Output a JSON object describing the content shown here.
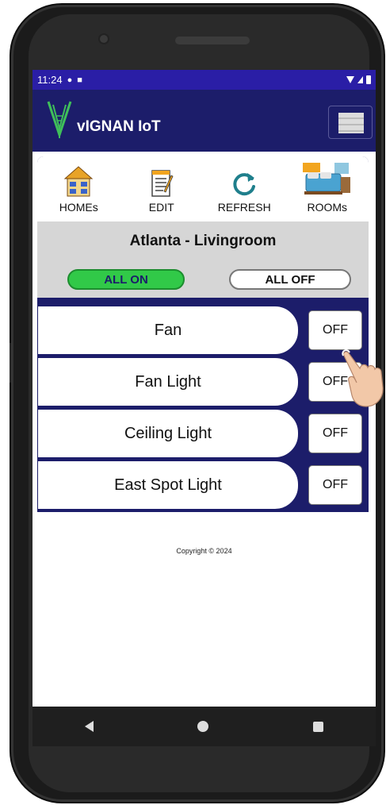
{
  "status_bar": {
    "time": "11:24"
  },
  "app_bar": {
    "title": "vIGNAN IoT"
  },
  "toolbar": {
    "homes_label": "HOMEs",
    "edit_label": "EDIT",
    "refresh_label": "REFRESH",
    "rooms_label": "ROOMs"
  },
  "room": {
    "title": "Atlanta - Livingroom",
    "all_on_label": "ALL ON",
    "all_off_label": "ALL OFF"
  },
  "devices": [
    {
      "name": "Fan",
      "state": "OFF"
    },
    {
      "name": "Fan Light",
      "state": "OFF"
    },
    {
      "name": "Ceiling Light",
      "state": "OFF"
    },
    {
      "name": "East Spot Light",
      "state": "OFF"
    }
  ],
  "footer": {
    "copyright": "Copyright © 2024"
  },
  "colors": {
    "app_bar": "#1c1d6a",
    "status_bar": "#2a1ea6",
    "all_on": "#31c948"
  }
}
